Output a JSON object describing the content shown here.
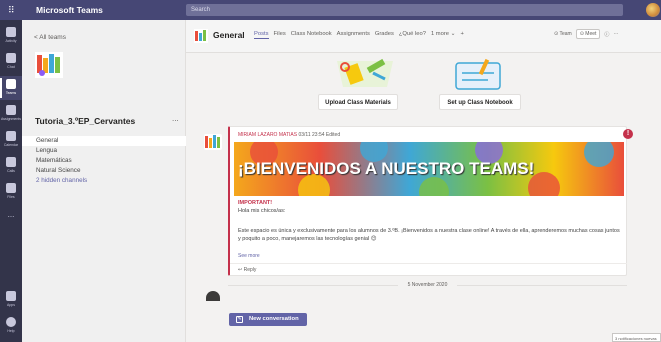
{
  "titlebar": {
    "app_name": "Microsoft Teams",
    "search_placeholder": "Search"
  },
  "rail": [
    {
      "label": "Activity",
      "icon": "bell-icon"
    },
    {
      "label": "Chat",
      "icon": "chat-icon"
    },
    {
      "label": "Teams",
      "icon": "teams-icon"
    },
    {
      "label": "Assignments",
      "icon": "assignments-icon"
    },
    {
      "label": "Calendar",
      "icon": "calendar-icon"
    },
    {
      "label": "Calls",
      "icon": "phone-icon"
    },
    {
      "label": "Files",
      "icon": "files-icon"
    },
    {
      "label": "...",
      "icon": "more-apps-icon"
    },
    {
      "label": "Apps",
      "icon": "apps-icon"
    },
    {
      "label": "Help",
      "icon": "help-icon"
    }
  ],
  "teampanel": {
    "back_label": "< All teams",
    "team_name": "Tutoria_3.ºEP_Cervantes",
    "more": "...",
    "channels": [
      {
        "label": "General"
      },
      {
        "label": "Lengua"
      },
      {
        "label": "Matemáticas"
      },
      {
        "label": "Natural Science"
      },
      {
        "label": "2 hidden channels"
      }
    ]
  },
  "header": {
    "title": "General",
    "tabs": [
      "Posts",
      "Files",
      "Class Notebook",
      "Assignments",
      "Grades",
      "¿Qué leo?",
      "1 more ⌄",
      "+"
    ],
    "team_btn": "⊙ Team",
    "meet_btn": "⊙ Meet",
    "info": "ⓘ",
    "more": "···"
  },
  "actions": {
    "upload": "Upload Class Materials",
    "notebook": "Set up Class Notebook"
  },
  "post": {
    "author": "MIRIAM LAZARO MATIAS",
    "meta": "03/11 23:54  Edited",
    "badge": "!",
    "banner": "¡BIENVENIDOS A NUESTRO TEAMS!",
    "important": "IMPORTANT!",
    "greeting": "Hola mis chicos/as:",
    "body": "Este espacio es única y exclusivamente para los alumnos de 3.ºB. ¡Bienvenidos a nuestra clase online! A través de ella, aprenderemos muchas cosas juntos y poquito a poco, manejaremos las tecnologías genial 😊",
    "see_more": "See more",
    "reply": "↩ Reply"
  },
  "date_separator": "5 November 2020",
  "new_conversation": "New conversation",
  "notification": "3 notificaciones nuevas"
}
